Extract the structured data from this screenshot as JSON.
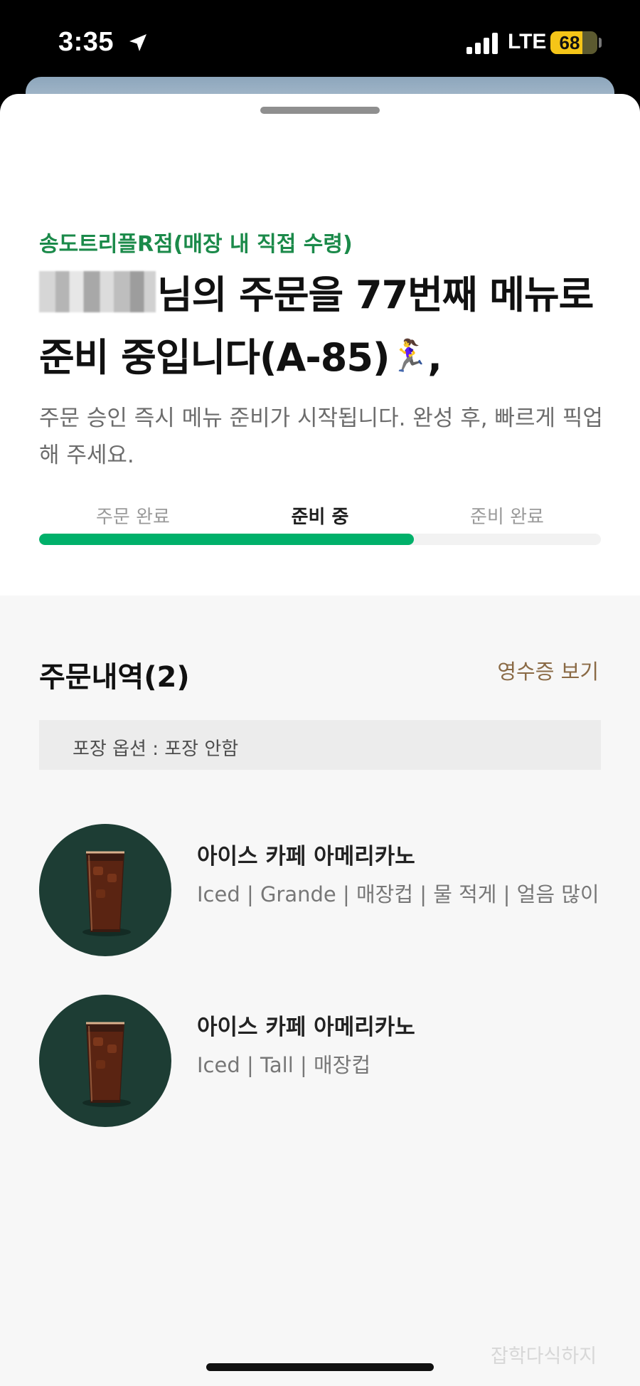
{
  "status_bar": {
    "time": "3:35",
    "location_icon": "location-arrow-icon",
    "signal_icon": "cellular-signal-icon",
    "network": "LTE",
    "battery": "68",
    "battery_fraction": 0.68
  },
  "order_status": {
    "store_name": "송도트리플R점(매장 내 직접 수령)",
    "headline_suffix": "님의 주문을 77번째 메뉴로 준비 중입니다(A-85)",
    "headline_emoji_icon": "running-woman-icon",
    "description": "주문 승인 즉시 메뉴 준비가 시작됩니다. 완성 후, 빠르게 픽업해 주세요.",
    "steps": [
      {
        "label": "주문 완료"
      },
      {
        "label": "준비 중"
      },
      {
        "label": "준비 완료"
      }
    ],
    "active_step": 1,
    "progress_fraction": 0.667
  },
  "order_details": {
    "title": "주문내역(2)",
    "receipt_link": "영수증 보기",
    "packaging_option": "포장 옵션 : 포장 안함",
    "items": [
      {
        "name": "아이스 카페 아메리카노",
        "options": "Iced | Grande | 매장컵 | 물 적게 | 얼음 많이",
        "image_icon": "iced-americano-icon"
      },
      {
        "name": "아이스 카페 아메리카노",
        "options": "Iced | Tall | 매장컵",
        "image_icon": "iced-americano-icon"
      }
    ]
  },
  "watermark": "잡학다식하지",
  "colors": {
    "accent_green": "#00b06a",
    "store_green": "#1b8a4a",
    "receipt_brown": "#8a6a45",
    "item_bg": "#1d3d34"
  }
}
